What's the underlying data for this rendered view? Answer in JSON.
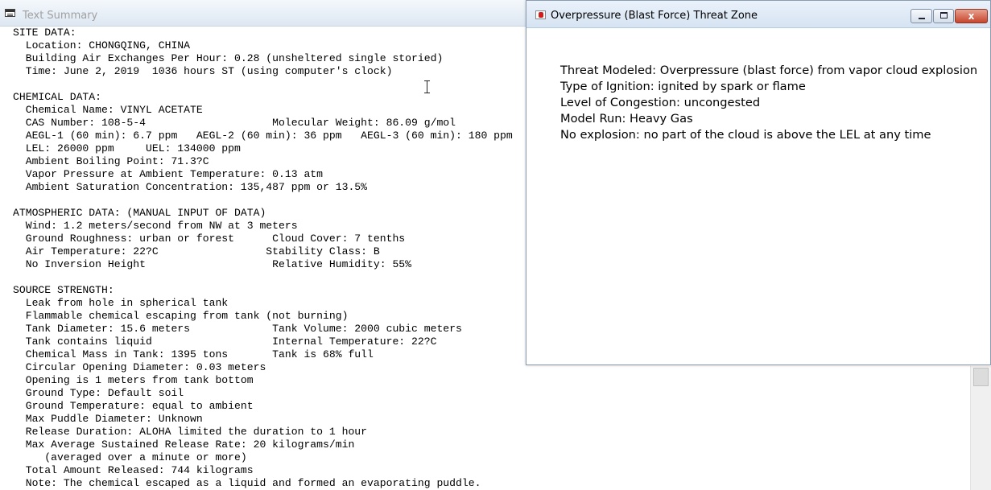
{
  "summary_window": {
    "title": "Text Summary",
    "lines": [
      "SITE DATA:",
      "  Location: CHONGQING, CHINA",
      "  Building Air Exchanges Per Hour: 0.28 (unsheltered single storied)",
      "  Time: June 2, 2019  1036 hours ST (using computer's clock)",
      "",
      "CHEMICAL DATA:",
      "  Chemical Name: VINYL ACETATE",
      "  CAS Number: 108-5-4                    Molecular Weight: 86.09 g/mol",
      "  AEGL-1 (60 min): 6.7 ppm   AEGL-2 (60 min): 36 ppm   AEGL-3 (60 min): 180 ppm",
      "  LEL: 26000 ppm     UEL: 134000 ppm",
      "  Ambient Boiling Point: 71.3?C",
      "  Vapor Pressure at Ambient Temperature: 0.13 atm",
      "  Ambient Saturation Concentration: 135,487 ppm or 13.5%",
      "",
      "ATMOSPHERIC DATA: (MANUAL INPUT OF DATA)",
      "  Wind: 1.2 meters/second from NW at 3 meters",
      "  Ground Roughness: urban or forest      Cloud Cover: 7 tenths",
      "  Air Temperature: 22?C                 Stability Class: B",
      "  No Inversion Height                    Relative Humidity: 55%",
      "",
      "SOURCE STRENGTH:",
      "  Leak from hole in spherical tank",
      "  Flammable chemical escaping from tank (not burning)",
      "  Tank Diameter: 15.6 meters             Tank Volume: 2000 cubic meters",
      "  Tank contains liquid                   Internal Temperature: 22?C",
      "  Chemical Mass in Tank: 1395 tons       Tank is 68% full",
      "  Circular Opening Diameter: 0.03 meters",
      "  Opening is 1 meters from tank bottom",
      "  Ground Type: Default soil",
      "  Ground Temperature: equal to ambient",
      "  Max Puddle Diameter: Unknown",
      "  Release Duration: ALOHA limited the duration to 1 hour",
      "  Max Average Sustained Release Rate: 20 kilograms/min",
      "     (averaged over a minute or more)",
      "  Total Amount Released: 744 kilograms",
      "  Note: The chemical escaped as a liquid and formed an evaporating puddle."
    ]
  },
  "threat_window": {
    "title": "Overpressure (Blast Force) Threat Zone",
    "close_glyph": "x",
    "lines": [
      "Threat Modeled: Overpressure (blast force) from vapor cloud explosion",
      "Type of Ignition: ignited by spark or flame",
      "Level of Congestion: uncongested",
      "Model Run: Heavy Gas",
      "No explosion: no part of the cloud is above the LEL at any time"
    ]
  },
  "icons": {
    "summary": "text-document-icon",
    "threat": "threat-zone-icon",
    "cursor": "text-cursor-icon"
  },
  "colors": {
    "close_button": "#c7452c",
    "threat_icon": "#d01e1e"
  }
}
